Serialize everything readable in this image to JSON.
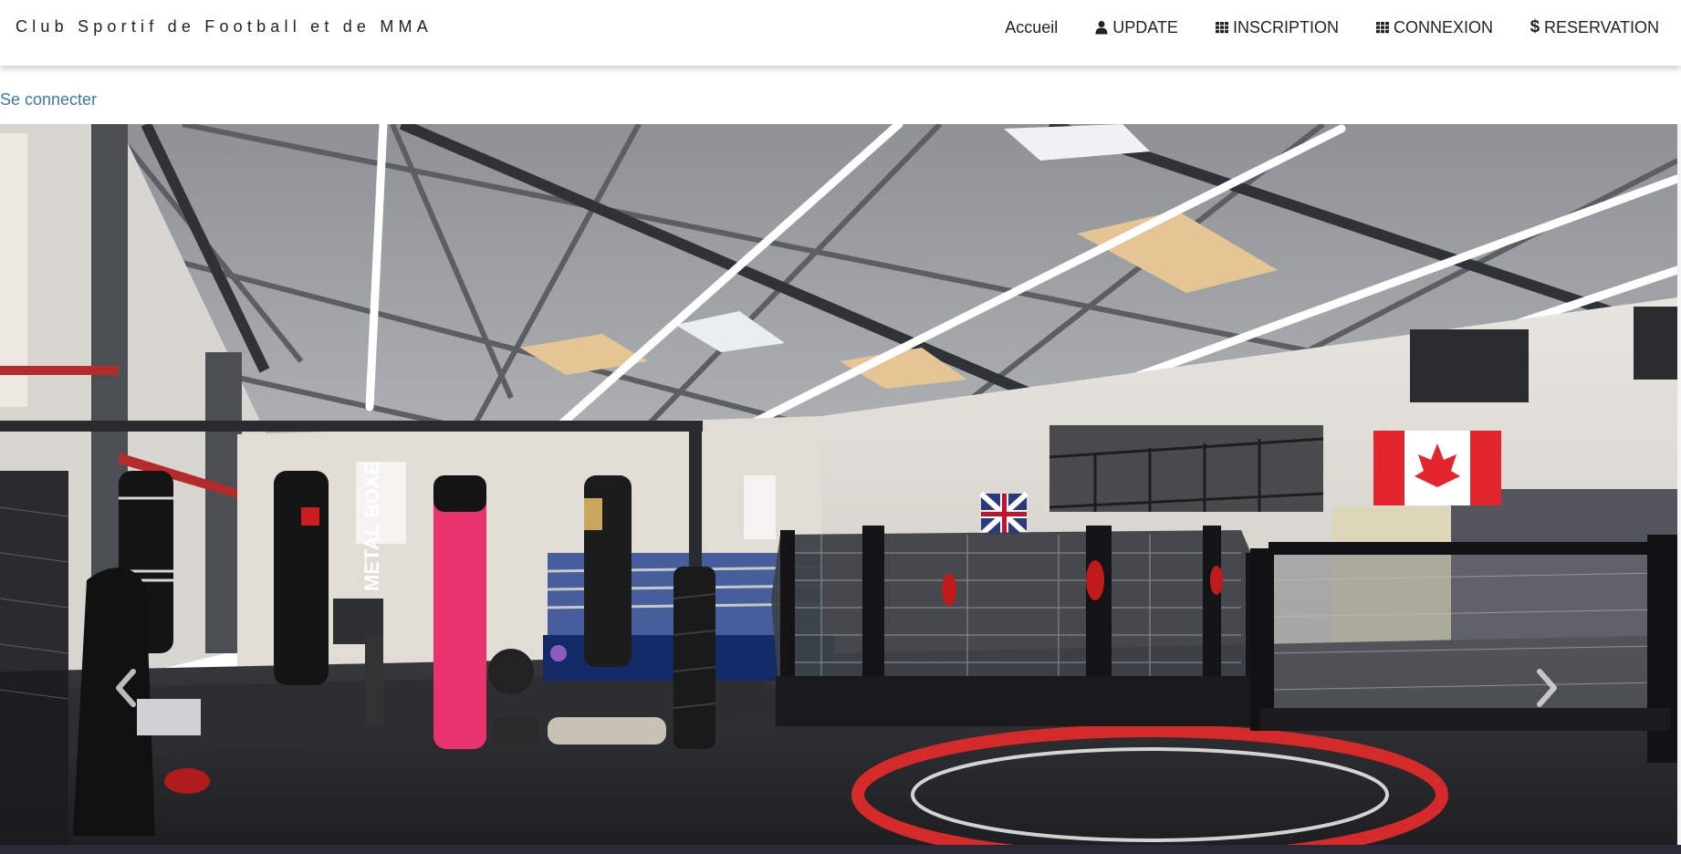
{
  "navbar": {
    "brand": "Club Sportif de Football et de MMA",
    "items": [
      {
        "label": "Accueil",
        "icon": ""
      },
      {
        "label": "UPDATE",
        "icon": "user-icon"
      },
      {
        "label": "INSCRIPTION",
        "icon": "grid-icon"
      },
      {
        "label": "CONNEXION",
        "icon": "grid-icon"
      },
      {
        "label": "RESERVATION",
        "icon": "dollar-icon"
      }
    ]
  },
  "login_link": "Se connecter",
  "carousel": {
    "image_label": "",
    "prev_icon": "chevron-left-icon",
    "next_icon": "chevron-right-icon",
    "bag_text": "METAL BOXE"
  },
  "colors": {
    "link": "#3b78b5",
    "text": "#222222",
    "bag_pink": "#e8336d",
    "mat_red": "#d42a2a"
  }
}
